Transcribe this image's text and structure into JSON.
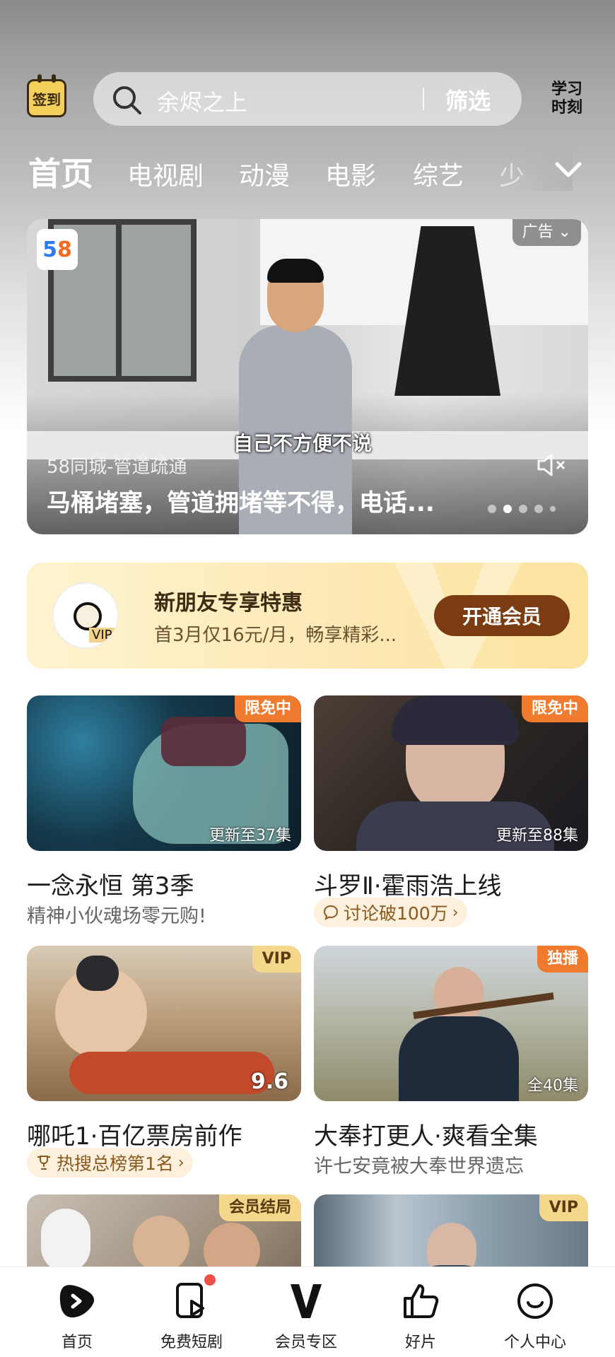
{
  "header": {
    "signin_label": "签到",
    "search_placeholder": "余烬之上",
    "filter_label": "筛选",
    "study_label_line1": "学习",
    "study_label_line2": "时刻"
  },
  "tabs": [
    {
      "label": "首页",
      "active": true
    },
    {
      "label": "电视剧"
    },
    {
      "label": "动漫"
    },
    {
      "label": "电影"
    },
    {
      "label": "综艺"
    },
    {
      "label": "少"
    }
  ],
  "banner": {
    "ad_label": "广告 ⌄",
    "logo_part1": "5",
    "logo_part2": "8",
    "subtitle": "自己不方便不说",
    "source": "58同城-管道疏通",
    "headline": "马桶堵塞，管道拥堵等不得，电话...",
    "page_count": 5,
    "current_page": 2
  },
  "vip_card": {
    "title": "新朋友专享特惠",
    "desc": "首3月仅16元/月，畅享精彩...",
    "button": "开通会员",
    "avatar_badge": "VIPO"
  },
  "videos": [
    {
      "badge": "限免中",
      "caption": "更新至37集",
      "title": "一念永恒 第3季",
      "sub": "精神小伙魂场零元购!"
    },
    {
      "badge": "限免中",
      "caption": "更新至88集",
      "title": "斗罗Ⅱ·霍雨浩上线",
      "pill": "讨论破100万"
    },
    {
      "badge": "VIP",
      "score": "9.6",
      "title": "哪吒1·百亿票房前作",
      "pill": "热搜总榜第1名"
    },
    {
      "badge": "独播",
      "caption": "全40集",
      "title": "大奉打更人·爽看全集",
      "sub": "许七安竟被大奉世界遗忘"
    },
    {
      "badge": "会员结局"
    },
    {
      "badge": "VIP"
    }
  ],
  "bottom_nav": [
    {
      "label": "首页",
      "icon": "play-logo-icon"
    },
    {
      "label": "免费短剧",
      "icon": "short-drama-icon"
    },
    {
      "label": "会员专区",
      "icon": "vip-v-icon"
    },
    {
      "label": "好片",
      "icon": "thumbs-up-icon"
    },
    {
      "label": "个人中心",
      "icon": "smiley-face-icon"
    }
  ],
  "colors": {
    "accent_orange": "#f07a2e",
    "vip_brown": "#7a3c10",
    "vip_gold": "#f5d78c"
  }
}
